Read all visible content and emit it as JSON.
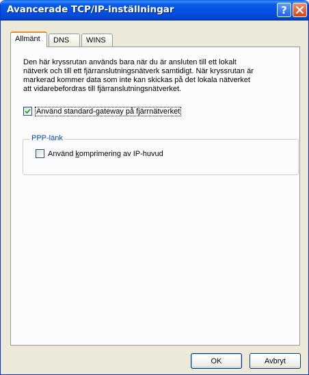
{
  "window": {
    "title": "Avancerade TCP/IP-inställningar"
  },
  "titlebar": {
    "help_label": "?"
  },
  "tabs": [
    {
      "label": "Allmänt",
      "active": true
    },
    {
      "label": "DNS",
      "active": false
    },
    {
      "label": "WINS",
      "active": false
    }
  ],
  "general": {
    "description_lines": [
      "Den här kryssrutan används bara när du är ansluten till ett lokalt",
      "nätverk och till ett fjärranslutningsnätverk samtidigt. När kryssrutan är",
      "markerad kommer data som inte kan skickas på det lokala nätverket",
      "att vidarebefordras till fjärranslutningsnätverket."
    ],
    "gateway_checkbox": {
      "label": "Använd standard-gateway på fjärrnätverket",
      "checked": true
    },
    "ppp_group": {
      "title": "PPP-länk",
      "compression_checkbox": {
        "label_pre": "Använd ",
        "label_ul": "k",
        "label_post": "omprimering av IP-huvud",
        "checked": false
      }
    }
  },
  "buttons": {
    "ok": "OK",
    "cancel": "Avbryt"
  },
  "colors": {
    "title_bar": "#0450e0",
    "group_title": "#0046d5",
    "tab_accent": "#e68b2c"
  }
}
